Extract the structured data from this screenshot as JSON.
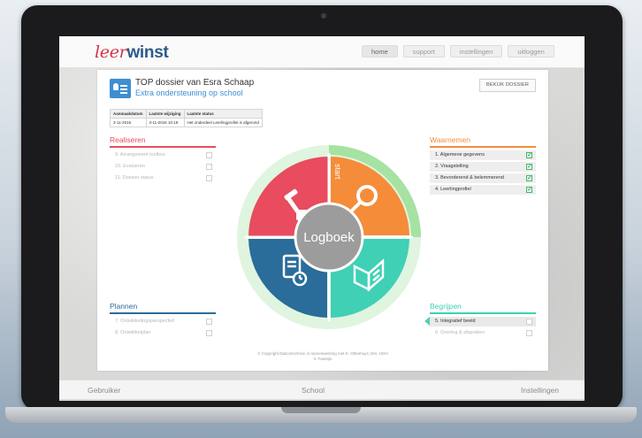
{
  "header": {
    "logo_part1": "leer",
    "logo_part2": "winst",
    "nav": [
      "home",
      "support",
      "instellingen",
      "uitloggen"
    ]
  },
  "dossier": {
    "title": "TOP dossier van Esra Schaap",
    "subtitle": "Extra ondersteuning op school",
    "view_button": "BEKIJK DOSSIER",
    "table_headers": [
      "Aanmaakdatum",
      "Laatste wijziging",
      "Laatste status"
    ],
    "table_row": [
      "3-11-2016",
      "3-11-2016 10:19",
      "Het onderdeel Leerlingprofiel is afgerond"
    ]
  },
  "sections": {
    "realiseren": {
      "title": "Realiseren",
      "items": [
        {
          "label": "9. Arrangement toolbox",
          "checked": false
        },
        {
          "label": "10. Evalueren",
          "checked": false
        },
        {
          "label": "11. Dossier status",
          "checked": false
        }
      ]
    },
    "waarnemen": {
      "title": "Waarnemen",
      "items": [
        {
          "label": "1. Algemene gegevens",
          "checked": true
        },
        {
          "label": "2. Vraagstelling",
          "checked": true
        },
        {
          "label": "3. Bevorderend & belemmerend",
          "checked": true
        },
        {
          "label": "4. Leerlingprofiel",
          "checked": true
        }
      ]
    },
    "plannen": {
      "title": "Plannen",
      "items": [
        {
          "label": "7. Ontwikkelingsperspectief",
          "checked": false
        },
        {
          "label": "8. Ontwikkelplan",
          "checked": false
        }
      ]
    },
    "begrijpen": {
      "title": "Begrijpen",
      "items": [
        {
          "label": "5. Integratief beeld",
          "checked": false,
          "current": true
        },
        {
          "label": "6. Overleg & afspraken",
          "checked": false
        }
      ]
    }
  },
  "wheel": {
    "center_label": "Logboek",
    "start_label": "start",
    "colors": {
      "red": "#e84c5e",
      "orange": "#f58c3a",
      "blue": "#2a6c9a",
      "teal": "#3fd0b5",
      "ring": "#dff5df",
      "ring_progress": "#a6e2a2",
      "center": "#9c9c9c"
    }
  },
  "copyright": "© Copyright Dalcomschool, in samenwerking met K. Ottenhuys, Drs. HOH II. Fanteijn",
  "bottom_bar": [
    "Gebruiker",
    "School",
    "Instellingen"
  ]
}
